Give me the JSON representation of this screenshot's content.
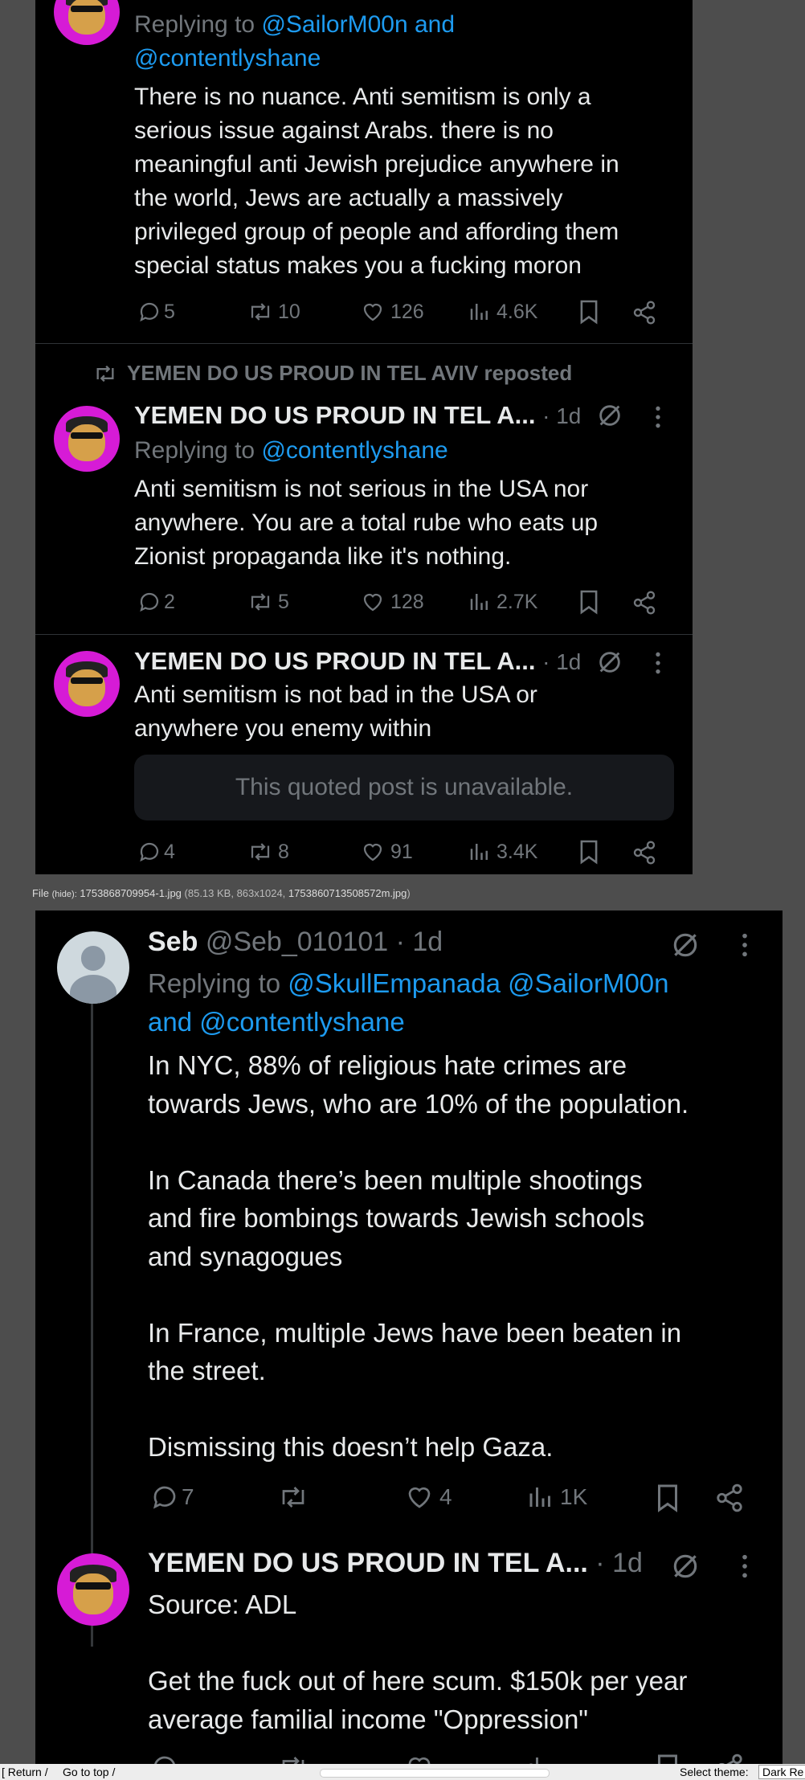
{
  "screenshot1": {
    "reply_a": {
      "replying_prefix": "Replying to",
      "replying_handles_l1": "@SailorM00n and",
      "replying_handles_l2": "@contentlyshane",
      "text_lines": [
        "There is no nuance. Anti semitism is only a",
        "serious issue against Arabs. there is no",
        "meaningful anti Jewish prejudice anywhere in",
        "the world, Jews are actually a massively",
        "privileged group of people and affording them",
        "special status makes you a fucking moron"
      ],
      "stats": {
        "replies": "5",
        "reposts": "10",
        "likes": "126",
        "views": "4.6K"
      }
    },
    "reply_b": {
      "repost_banner": "YEMEN DO US PROUD IN TEL AVIV reposted",
      "author": "YEMEN DO US PROUD IN TEL A...",
      "time": "· 1d",
      "replying_prefix": "Replying to",
      "replying_handles": "@contentlyshane",
      "text_lines": [
        "Anti semitism is not serious in the USA nor",
        "anywhere. You are a total rube who eats up",
        "Zionist propaganda like it's nothing."
      ],
      "stats": {
        "replies": "2",
        "reposts": "5",
        "likes": "128",
        "views": "2.7K"
      }
    },
    "reply_c": {
      "author": "YEMEN DO US PROUD IN TEL A...",
      "time": "· 1d",
      "text_lines": [
        "Anti semitism is not bad in the USA or",
        "anywhere you enemy within"
      ],
      "quoted": "This quoted post is unavailable.",
      "stats": {
        "replies": "4",
        "reposts": "8",
        "likes": "91",
        "views": "3.4K"
      }
    }
  },
  "file_caption": {
    "prefix": "File",
    "hide": "(hide):",
    "filename": "1753868709954-1.jpg",
    "details": "(85.13 KB, 863x1024,",
    "original": "1753860713508572m.jpg",
    "close": ")"
  },
  "screenshot2": {
    "post_seb": {
      "author": "Seb",
      "handle_time": "@Seb_010101 · 1d",
      "replying_prefix": "Replying to",
      "replying_handles_l1": "@SkullEmpanada @SailorM00n",
      "replying_and": "and",
      "replying_handles_l2": "@contentlyshane",
      "text_lines": [
        "In NYC, 88% of religious hate crimes are",
        "towards Jews, who are 10% of the population.",
        "",
        "In Canada there’s been multiple shootings",
        "and fire bombings towards Jewish schools",
        "and synagogues",
        "",
        "In France, multiple Jews have been beaten in",
        "the street.",
        "",
        "Dismissing this doesn’t help Gaza."
      ],
      "stats": {
        "replies": "7",
        "likes": "4",
        "views": "1K"
      }
    },
    "post_yemen": {
      "author": "YEMEN DO US PROUD IN TEL A...",
      "time": "· 1d",
      "text_lines": [
        "Source: ADL",
        "",
        "Get the fuck out of here scum. $150k per year",
        "average familial income \"Oppression\""
      ]
    }
  },
  "bottom_bar": {
    "return": "[ Return /",
    "go_top": "Go to top /",
    "select_theme": "Select theme:",
    "theme_value": "Dark Re"
  },
  "colors": {
    "link": "#1d9bf0",
    "muted": "#71767b",
    "avatar_bg": "#d61bd6",
    "background": "#000000"
  }
}
